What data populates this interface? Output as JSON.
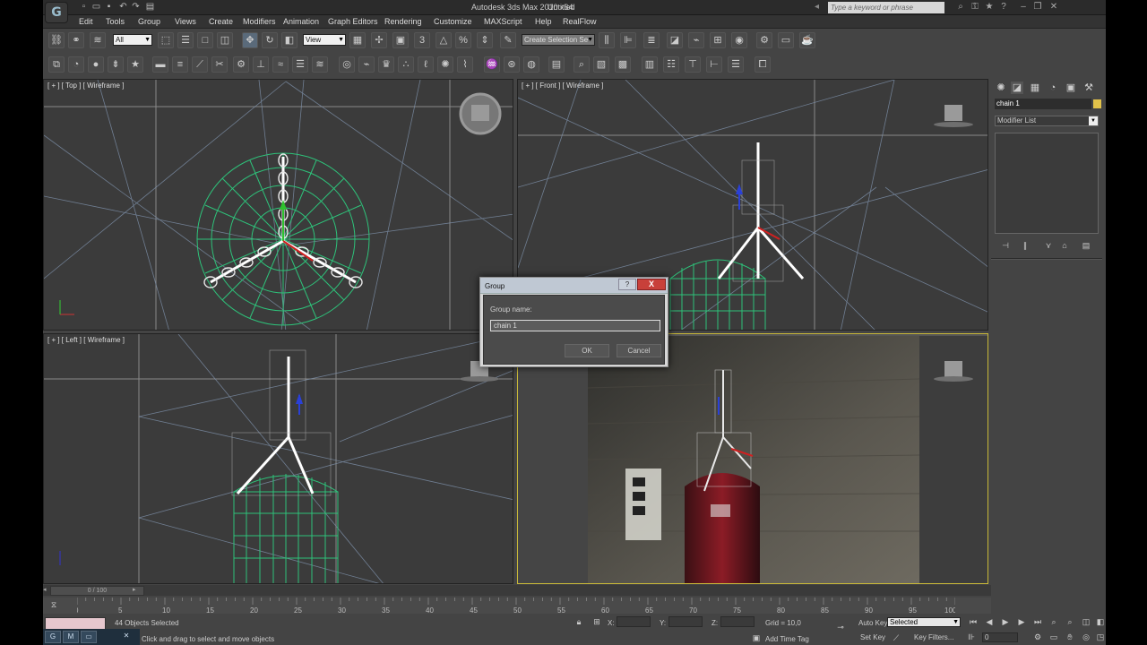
{
  "app": {
    "title": "Autodesk 3ds Max 2010 x64",
    "document": "Untitled",
    "logo": "3ds-max-logo",
    "search_placeholder": "Type a keyword or phrase"
  },
  "menu": [
    "Edit",
    "Tools",
    "Group",
    "Views",
    "Create",
    "Modifiers",
    "Animation",
    "Graph Editors",
    "Rendering",
    "Customize",
    "MAXScript",
    "Help",
    "RealFlow"
  ],
  "toolbar": {
    "selection_filter": "All",
    "reference_coord": "View",
    "named_selection_placeholder": "Create Selection Se"
  },
  "viewports": {
    "top": "[ + ] [ Top ] [ Wireframe ]",
    "front": "[ + ] [ Front ] [ Wireframe ]",
    "left": "[ + ] [ Left ] [ Wireframe ]"
  },
  "command_panel": {
    "object_name": "chain 1",
    "object_color": "#e3c34a",
    "modifier_list": "Modifier List"
  },
  "dialog": {
    "title": "Group",
    "help": "?",
    "close": "X",
    "label": "Group name:",
    "value": "chain 1",
    "ok": "OK",
    "cancel": "Cancel"
  },
  "timeline": {
    "slider": "0 / 100",
    "ticks": [
      "0",
      "5",
      "10",
      "15",
      "20",
      "25",
      "30",
      "35",
      "40",
      "45",
      "50",
      "55",
      "60",
      "65",
      "70",
      "75",
      "80",
      "85",
      "90",
      "95",
      "100"
    ]
  },
  "status": {
    "selection": "44 Objects Selected",
    "prompt": "Click and drag to select and move objects",
    "x_label": "X:",
    "y_label": "Y:",
    "z_label": "Z:",
    "grid": "Grid = 10,0",
    "add_time_tag": "Add Time Tag",
    "auto_key": "Auto Key",
    "set_key": "Set Key",
    "key_mode": "Selected",
    "key_filters": "Key Filters...",
    "frame": "0"
  },
  "colors": {
    "wire_green": "#2ec27a",
    "background": "#444444"
  }
}
